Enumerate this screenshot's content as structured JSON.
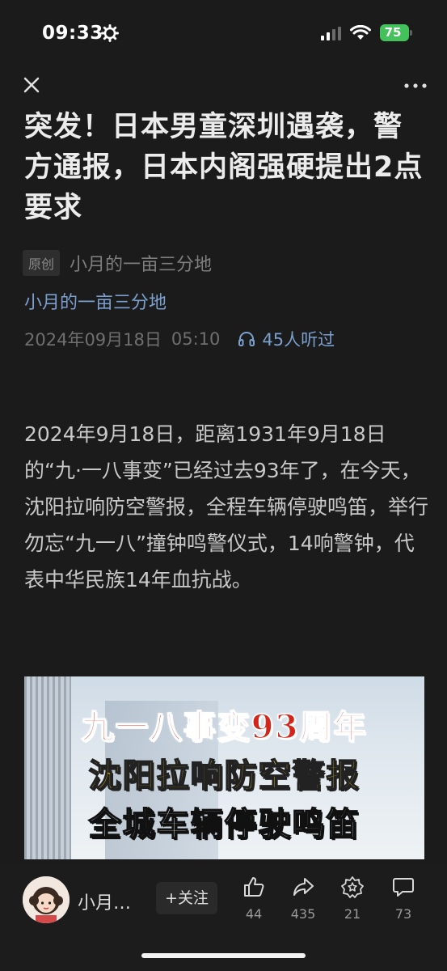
{
  "status_bar": {
    "time": "09:33",
    "battery": "75",
    "battery_color": "#43c15b"
  },
  "nav": {
    "close_icon": "close-icon",
    "more_icon": "more-icon"
  },
  "article": {
    "title": "突发！日本男童深圳遇袭，警方通报，日本内阁强硬提出2点要求",
    "badge": "原创",
    "source": "小月的一亩三分地",
    "author": "小月的一亩三分地",
    "date": "2024年09月18日",
    "time": "05:10",
    "listens": "45人听过",
    "body": "2024年9月18日，距离1931年9月18日的“九·一八事变”已经过去93年了，在今天，沈阳拉响防空警报，全程车辆停驶鸣笛，举行勿忘“九一八”撞钟鸣警仪式，14响警钟，代表中华民族14年血抗战。",
    "image_text": [
      "九一八事变93周年",
      "沈阳拉响防空警报",
      "全城车辆停驶鸣笛"
    ]
  },
  "bottom_bar": {
    "author_short": "小月…",
    "follow": "+关注",
    "likes": "44",
    "shares": "435",
    "favorites": "21",
    "comments": "73"
  },
  "colors": {
    "background": "#1b1b1b",
    "link": "#7b9fcf"
  }
}
